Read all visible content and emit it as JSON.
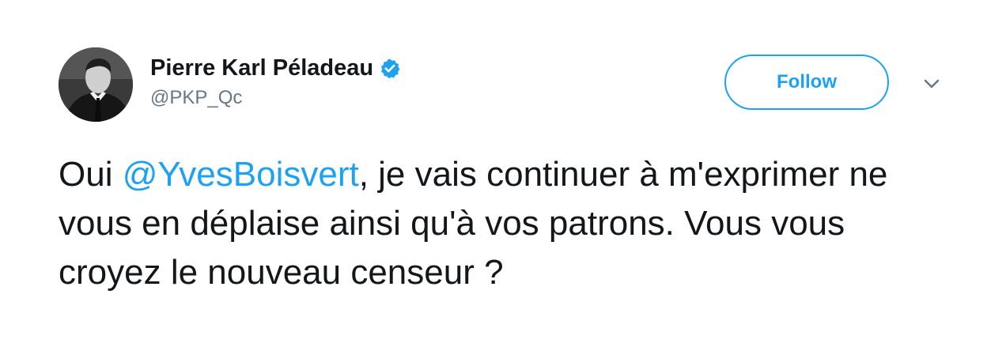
{
  "tweet": {
    "user": {
      "display_name": "Pierre Karl Péladeau",
      "screen_name": "@PKP_Qc",
      "verified": true,
      "avatar_icon": "profile-photo"
    },
    "follow_label": "Follow",
    "menu_icon": "chevron-down-icon",
    "text": {
      "part1": "Oui ",
      "mention": "@YvesBoisvert",
      "part2": ", je vais continuer à m'exprimer ne vous en déplaise ainsi qu'à vos patrons. Vous vous croyez le nouveau censeur ?"
    },
    "colors": {
      "accent": "#1da1f2",
      "text": "#14171a",
      "secondary": "#657786"
    }
  }
}
